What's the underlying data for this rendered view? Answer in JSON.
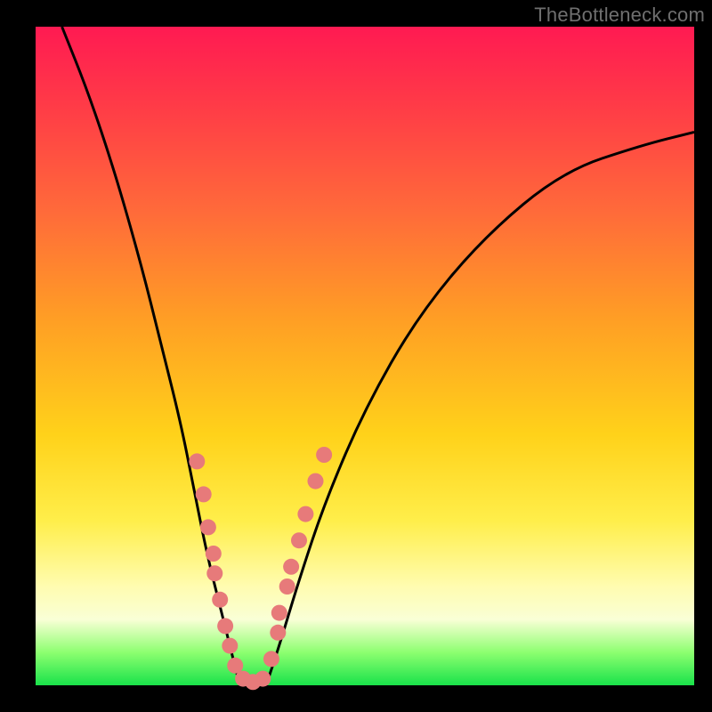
{
  "watermark": {
    "text": "TheBottleneck.com"
  },
  "chart_data": {
    "type": "line",
    "title": "",
    "xlabel": "",
    "ylabel": "",
    "xlim": [
      0,
      100
    ],
    "ylim": [
      0,
      100
    ],
    "grid": false,
    "legend": false,
    "background_gradient": {
      "direction": "vertical",
      "stops": [
        {
          "pos": 0,
          "color": "#ff1a52"
        },
        {
          "pos": 45,
          "color": "#ffa024"
        },
        {
          "pos": 75,
          "color": "#ffee4a"
        },
        {
          "pos": 92,
          "color": "#f9ffd6"
        },
        {
          "pos": 100,
          "color": "#19e24a"
        }
      ]
    },
    "series": [
      {
        "name": "bottleneck-curve-left",
        "color": "#000000",
        "x": [
          4,
          8,
          12,
          16,
          19,
          22,
          24,
          26,
          28,
          30,
          31
        ],
        "y": [
          100,
          90,
          78,
          64,
          52,
          40,
          30,
          20,
          12,
          4,
          0
        ]
      },
      {
        "name": "bottleneck-curve-right",
        "color": "#000000",
        "x": [
          35,
          37,
          40,
          44,
          50,
          58,
          68,
          80,
          92,
          100
        ],
        "y": [
          0,
          6,
          16,
          28,
          42,
          56,
          68,
          78,
          82,
          84
        ]
      }
    ],
    "markers": {
      "name": "highlight-dots",
      "color": "#e77a7a",
      "radius": 9,
      "points": [
        {
          "x": 24.5,
          "y": 34
        },
        {
          "x": 25.5,
          "y": 29
        },
        {
          "x": 26.2,
          "y": 24
        },
        {
          "x": 27.0,
          "y": 20
        },
        {
          "x": 27.2,
          "y": 17
        },
        {
          "x": 28.0,
          "y": 13
        },
        {
          "x": 28.8,
          "y": 9
        },
        {
          "x": 29.5,
          "y": 6
        },
        {
          "x": 30.3,
          "y": 3
        },
        {
          "x": 31.5,
          "y": 1
        },
        {
          "x": 33.0,
          "y": 0.5
        },
        {
          "x": 34.5,
          "y": 1
        },
        {
          "x": 35.8,
          "y": 4
        },
        {
          "x": 36.8,
          "y": 8
        },
        {
          "x": 37.0,
          "y": 11
        },
        {
          "x": 38.2,
          "y": 15
        },
        {
          "x": 38.8,
          "y": 18
        },
        {
          "x": 40.0,
          "y": 22
        },
        {
          "x": 41.0,
          "y": 26
        },
        {
          "x": 42.5,
          "y": 31
        },
        {
          "x": 43.8,
          "y": 35
        }
      ]
    }
  }
}
